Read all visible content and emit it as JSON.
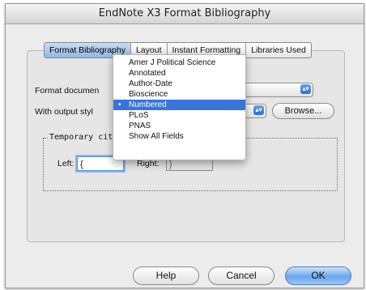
{
  "window": {
    "title": "EndNote X3 Format Bibliography"
  },
  "tabs": [
    {
      "label": "Format Bibliography",
      "active": true
    },
    {
      "label": "Layout",
      "active": false
    },
    {
      "label": "Instant Formatting",
      "active": false
    },
    {
      "label": "Libraries Used",
      "active": false
    }
  ],
  "form": {
    "format_document_label": "Format documen",
    "output_style_label": "With output styl",
    "browse_label": "Browse..."
  },
  "temporary_citations": {
    "title": "Temporary cita",
    "left_label": "Left:",
    "left_value": "{",
    "right_label": "Right:",
    "right_value": "}"
  },
  "style_menu": {
    "items": [
      "Amer J Political Science",
      "Annotated",
      "Author-Date",
      "Bioscience",
      "Numbered",
      "PLoS",
      "PNAS",
      "Show All Fields"
    ],
    "selected_index": 4,
    "check_glyph": "•"
  },
  "buttons": {
    "help": "Help",
    "cancel": "Cancel",
    "ok": "OK"
  },
  "colors": {
    "selection": "#3a74d8",
    "default_button": "#6aa6ec"
  }
}
